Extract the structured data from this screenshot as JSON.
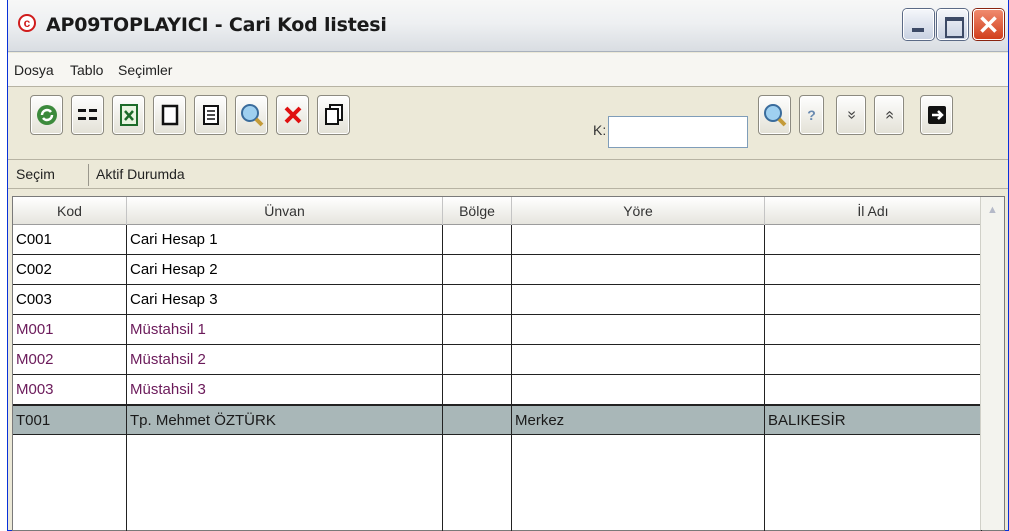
{
  "window": {
    "title": "AP09TOPLAYICI - Cari Kod listesi",
    "app_icon": "app-logo-icon",
    "close_glyph": "✕"
  },
  "menubar": {
    "items": [
      "Dosya",
      "Tablo",
      "Seçimler"
    ]
  },
  "toolbar": {
    "buttons": [
      {
        "name": "refresh-icon"
      },
      {
        "name": "list-icon"
      },
      {
        "name": "excel-export-icon"
      },
      {
        "name": "new-document-icon"
      },
      {
        "name": "edit-document-icon"
      },
      {
        "name": "search-icon"
      },
      {
        "name": "delete-icon"
      },
      {
        "name": "copy-icon"
      }
    ],
    "search_label": "K:",
    "search_value": "",
    "right_buttons": [
      {
        "name": "search-go-icon"
      },
      {
        "name": "help-icon",
        "glyph": "?"
      },
      {
        "name": "expand-down-icon",
        "glyph": "»"
      },
      {
        "name": "collapse-up-icon",
        "glyph": "«"
      },
      {
        "name": "exit-icon"
      }
    ]
  },
  "tabs": [
    "Seçim",
    "Aktif Durumda"
  ],
  "grid": {
    "columns": [
      "Kod",
      "Ünvan",
      "Bölge",
      "Yöre",
      "İl Adı"
    ],
    "rows": [
      {
        "kod": "C001",
        "unvan": "Cari Hesap 1",
        "bolge": "",
        "yore": "",
        "il": "",
        "color": "#000000"
      },
      {
        "kod": "C002",
        "unvan": "Cari Hesap 2",
        "bolge": "",
        "yore": "",
        "il": "",
        "color": "#000000"
      },
      {
        "kod": "C003",
        "unvan": "Cari Hesap 3",
        "bolge": "",
        "yore": "",
        "il": "",
        "color": "#000000"
      },
      {
        "kod": "M001",
        "unvan": "Müstahsil 1",
        "bolge": "",
        "yore": "",
        "il": "",
        "color": "#6b1a5a"
      },
      {
        "kod": "M002",
        "unvan": "Müstahsil 2",
        "bolge": "",
        "yore": "",
        "il": "",
        "color": "#6b1a5a"
      },
      {
        "kod": "M003",
        "unvan": "Müstahsil 3",
        "bolge": "",
        "yore": "",
        "il": "",
        "color": "#6b1a5a"
      },
      {
        "kod": "T001",
        "unvan": "Tp. Mehmet ÖZTÜRK",
        "bolge": "",
        "yore": "Merkez",
        "il": "BALIKESİR",
        "color": "#1a1a1a",
        "selected": true
      }
    ],
    "scroll_up_glyph": "▲"
  },
  "colors": {
    "selected_row": "#a9b7b8",
    "title_close": "#d13e1c"
  }
}
